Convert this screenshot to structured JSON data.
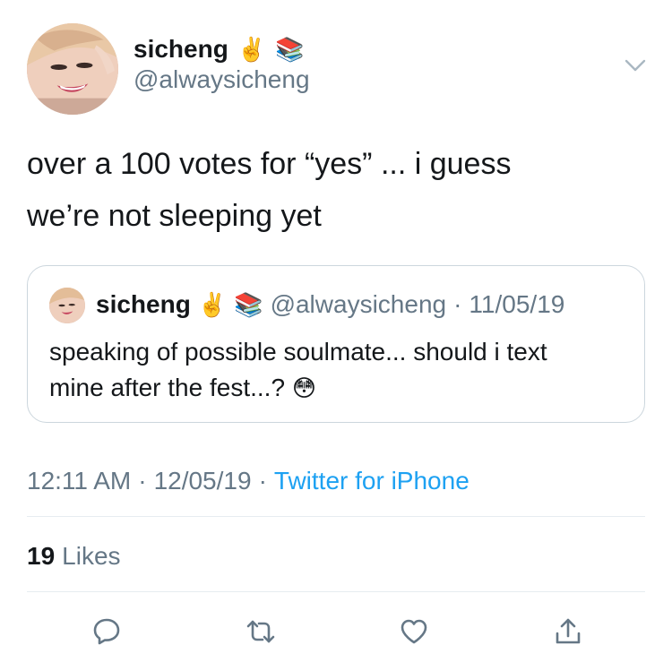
{
  "author": {
    "display_name": "sicheng",
    "handle": "@alwaysicheng",
    "emojis": [
      "✌️",
      "📚"
    ]
  },
  "tweet": {
    "text_line1": "over a 100 votes for “yes” ... i guess",
    "text_line2": "we’re not sleeping yet"
  },
  "quoted_tweet": {
    "display_name": "sicheng",
    "emojis": [
      "✌️",
      "📚"
    ],
    "handle": "@alwaysicheng",
    "separator": "·",
    "date": "11/05/19",
    "text_line1": "speaking of possible soulmate... should i text",
    "text_line2": "mine after the fest...?",
    "text_emoji": "😳"
  },
  "meta": {
    "time": "12:11 AM",
    "separator": "·",
    "date": "12/05/19",
    "source": "Twitter for iPhone"
  },
  "stats": {
    "likes_count": "19",
    "likes_label": "Likes"
  },
  "actions": [
    "reply-icon",
    "retweet-icon",
    "like-icon",
    "share-icon"
  ],
  "colors": {
    "text": "#14171a",
    "secondary": "#657786",
    "link": "#1da1f2",
    "border": "#ccd6dd"
  }
}
